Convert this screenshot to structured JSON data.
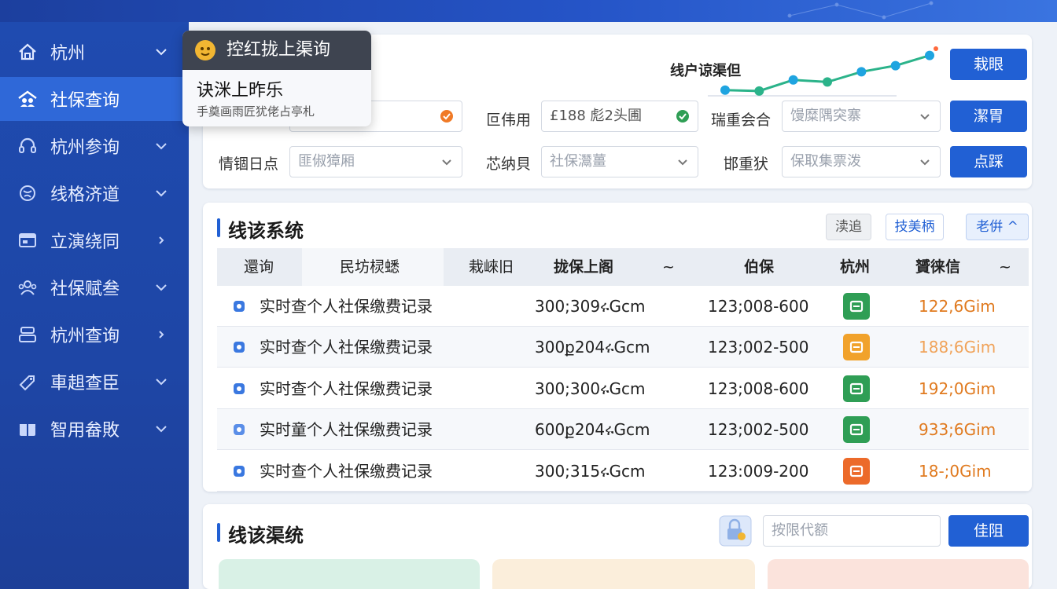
{
  "sidebar": {
    "items": [
      {
        "label": "杭州",
        "icon": "home-icon",
        "chevron": "down"
      },
      {
        "label": "社保查询",
        "icon": "shield-people-icon",
        "chevron": "",
        "active": true
      },
      {
        "label": "杭州参询",
        "icon": "headset-icon",
        "chevron": "down"
      },
      {
        "label": "线格济道",
        "icon": "globe-icon",
        "chevron": "down"
      },
      {
        "label": "立演绕同",
        "icon": "window-icon",
        "chevron": "right"
      },
      {
        "label": "社保赋叁",
        "icon": "people-icon",
        "chevron": "down"
      },
      {
        "label": "杭州查询",
        "icon": "building-icon",
        "chevron": "right"
      },
      {
        "label": "車趄查臣",
        "icon": "tag-icon",
        "chevron": "down"
      },
      {
        "label": "智用畚敗",
        "icon": "gift-icon",
        "chevron": "down"
      }
    ]
  },
  "tooltip": {
    "header": "控红拢上渠询",
    "line1": "诀洣上昨乐",
    "line2": "手奠画雨匠犹佬占亭札"
  },
  "trend": {
    "title": "线户谅渠但",
    "points": [
      0.1,
      0.08,
      0.35,
      0.3,
      0.55,
      0.7,
      0.95
    ]
  },
  "filter": {
    "row1": {
      "label2": "叵伟用",
      "value2": "£188 彪2头圃",
      "label3": "瑞重会合",
      "placeholder3": "馒糜隅突寨"
    },
    "row2": {
      "label1": "情锢日点",
      "placeholder1": "匪俶獐厢",
      "label2": "芯纳貝",
      "placeholder2": "社保灊薑",
      "label3": "邯重犾",
      "placeholder3": "保取集票泼"
    },
    "buttons": [
      "栽眼",
      "潔胃",
      "点踩"
    ]
  },
  "table_section": {
    "title": "线该系统",
    "tools": [
      "渎追",
      "技美柄",
      "老倂 ^"
    ],
    "columns": [
      "還询",
      "民坊棂蟋",
      "栽崍旧",
      "拢保上阁",
      "~",
      "伯保",
      "杭州",
      "贇徕信",
      "~"
    ],
    "rows": [
      {
        "name": "实时查个人社保缴费记录",
        "c1": "300;309ሩGcm",
        "c2": "123;008-600",
        "amount": "122,6Gim",
        "amount_color": "#e07a1f",
        "badge_color": "#2f9e55",
        "icon_color": "#3a78e0"
      },
      {
        "name": "实时查个人社保缴费记录",
        "c1": "300ք204ሩGcm",
        "c2": "123;002-500",
        "amount": "188;6Gim",
        "amount_color": "#f0a35a",
        "badge_color": "#f1a22b",
        "icon_color": "#3a78e0"
      },
      {
        "name": "实时查个人社保缴费记录",
        "c1": "300;300ሩGcm",
        "c2": "123;008-600",
        "amount": "192;0Gim",
        "amount_color": "#e07a1f",
        "badge_color": "#2f9e55",
        "icon_color": "#3a78e0"
      },
      {
        "name": "实时童个人社保缴费记录",
        "c1": "600ք204ሩGcm",
        "c2": "123;002-500",
        "amount": "933;6Gim",
        "amount_color": "#e07a1f",
        "badge_color": "#2f9e55",
        "icon_color": "#5a8ee8"
      },
      {
        "name": "实时查个人社保缴费记录",
        "c1": "300;315ሩGcm",
        "c2": "123:009-200",
        "amount": "18-;0Gim",
        "amount_color": "#e07a1f",
        "badge_color": "#ec6a2a",
        "icon_color": "#3a78e0"
      }
    ]
  },
  "bottom_section": {
    "title": "线该渠统",
    "search_placeholder": "按限代额",
    "button": "佳阻",
    "cards": [
      {
        "color": "#d9f1e6"
      },
      {
        "color": "#fbeedb"
      },
      {
        "color": "#fbe3dc"
      }
    ]
  },
  "colors": {
    "primary": "#2160d4",
    "sidebar": "#1f4bb0",
    "success": "#2f9e55",
    "warning": "#e07a1f"
  }
}
